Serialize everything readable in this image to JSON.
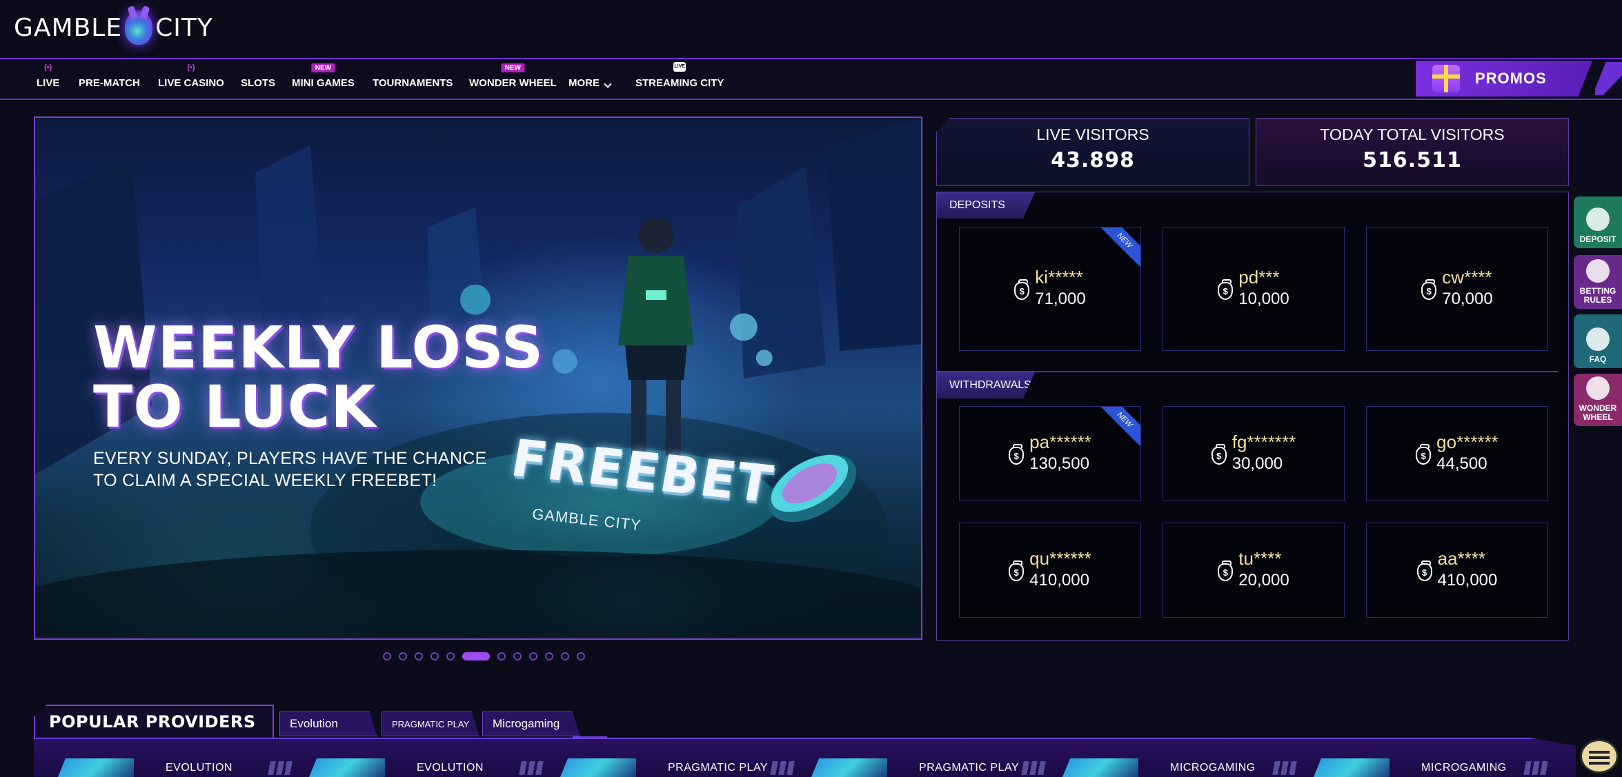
{
  "brand": {
    "left": "GAMBLE",
    "right": "CITY"
  },
  "nav": {
    "items": [
      {
        "label": "LIVE",
        "badge": "live"
      },
      {
        "label": "PRE-MATCH",
        "badge": ""
      },
      {
        "label": "LIVE CASINO",
        "badge": "live"
      },
      {
        "label": "SLOTS",
        "badge": ""
      },
      {
        "label": "MINI GAMES",
        "badge": "NEW"
      },
      {
        "label": "TOURNAMENTS",
        "badge": ""
      },
      {
        "label": "WONDER WHEEL",
        "badge": "NEW"
      },
      {
        "label": "MORE",
        "badge": ""
      },
      {
        "label": "STREAMING CITY",
        "badge": "tv"
      }
    ],
    "new_badge": "NEW",
    "live_icon": "(•)",
    "tv_icon": "LIVE",
    "promos_label": "PROMOS"
  },
  "banner": {
    "title_line1": "WEEKLY LOSS",
    "title_line2": "TO LUCK",
    "sub_line1": "EVERY SUNDAY, PLAYERS HAVE THE CHANCE",
    "sub_line2": "TO CLAIM A SPECIAL WEEKLY FREEBET!",
    "freebet": "FREEBET",
    "freebet_brand": "GAMBLE CITY",
    "slide_count": 12,
    "active_slide": 6
  },
  "stats": {
    "live_label": "LIVE VISITORS",
    "live_value": "43.898",
    "total_label": "TODAY TOTAL VISITORS",
    "total_value": "516.511"
  },
  "activity": {
    "deposits_label": "DEPOSITS",
    "withdrawals_label": "WITHDRAWALS",
    "ribbon": "NEW",
    "money_symbol": "$",
    "deposits": [
      {
        "user": "ki*****",
        "amount": "71,000",
        "is_new": true
      },
      {
        "user": "pd***",
        "amount": "10,000",
        "is_new": false
      },
      {
        "user": "cw****",
        "amount": "70,000",
        "is_new": false
      }
    ],
    "withdrawals": [
      {
        "user": "pa******",
        "amount": "130,500",
        "is_new": true
      },
      {
        "user": "fg*******",
        "amount": "30,000",
        "is_new": false
      },
      {
        "user": "go******",
        "amount": "44,500",
        "is_new": false
      },
      {
        "user": "qu******",
        "amount": "410,000",
        "is_new": false
      },
      {
        "user": "tu****",
        "amount": "20,000",
        "is_new": false
      },
      {
        "user": "aa****",
        "amount": "410,000",
        "is_new": false
      }
    ]
  },
  "side_menu": [
    {
      "label": "DEPOSIT",
      "icon": "deposit-icon",
      "color": "#1f7a5c"
    },
    {
      "label": "BETTING RULES",
      "icon": "betting-rules-icon",
      "color": "#6a2a8c"
    },
    {
      "label": "FAQ",
      "icon": "faq-icon",
      "color": "#1f6a7a"
    },
    {
      "label": "WONDER WHEEL",
      "icon": "wonder-wheel-icon",
      "color": "#8a2a6a"
    }
  ],
  "providers": {
    "title": "POPULAR PROVIDERS",
    "tabs": [
      "Evolution",
      "PRAGMATIC PLAY",
      "Microgaming"
    ],
    "cards": [
      "EVOLUTION",
      "EVOLUTION",
      "PRAGMATIC PLAY",
      "PRAGMATIC PLAY",
      "MICROGAMING",
      "MICROGAMING"
    ]
  },
  "colors": {
    "accent": "#7a3fd6",
    "background": "#0b0b1a",
    "username": "#f3dfa0",
    "ribbon": "#2d54d6"
  }
}
